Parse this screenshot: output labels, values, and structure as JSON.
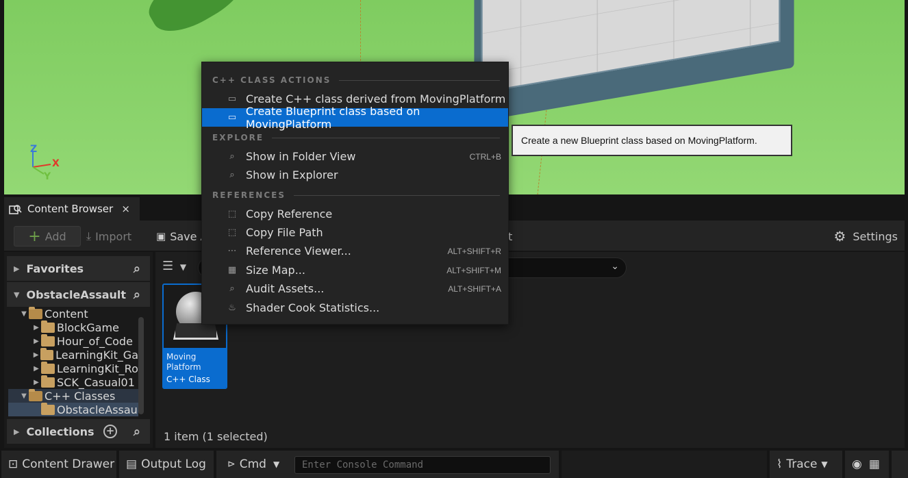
{
  "viewport": {
    "axis": {
      "z": "Z",
      "x": "X",
      "y": "Y"
    },
    "colors": {
      "ground": "#8fd46f",
      "x_axis": "#e03a2a",
      "y_axis": "#70c040",
      "z_axis": "#3a7ad8"
    }
  },
  "content_browser_tab": {
    "title": "Content Browser",
    "close": "×"
  },
  "toolbar": {
    "add_label": "Add",
    "import_label": "Import",
    "save_label": "Save A",
    "trailing_fragment": "t",
    "settings_label": "Settings"
  },
  "left_panel": {
    "favorites_label": "Favorites",
    "project_label": "ObstacleAssault",
    "collections_label": "Collections",
    "tree": [
      {
        "label": "Content"
      },
      {
        "label": "BlockGame"
      },
      {
        "label": "Hour_of_Code"
      },
      {
        "label": "LearningKit_Ga"
      },
      {
        "label": "LearningKit_Ro"
      },
      {
        "label": "SCK_Casual01"
      },
      {
        "label": "C++ Classes"
      },
      {
        "label": "ObstacleAssau"
      }
    ]
  },
  "assets": {
    "tile": {
      "name_line1": "Moving",
      "name_line2": "Platform",
      "type": "C++ Class"
    },
    "status": "1 item (1 selected)"
  },
  "bottom_bar": {
    "content_drawer": "Content Drawer",
    "output_log": "Output Log",
    "cmd": "Cmd",
    "console_placeholder": "Enter Console Command",
    "trace": "Trace"
  },
  "context_menu": {
    "sections": {
      "cpp_class_actions": "C++ CLASS ACTIONS",
      "explore": "EXPLORE",
      "references": "REFERENCES"
    },
    "items": {
      "create_cpp": {
        "label": "Create C++ class derived from MovingPlatform",
        "shortcut": ""
      },
      "create_bp": {
        "label": "Create Blueprint class based on MovingPlatform",
        "shortcut": ""
      },
      "folder_view": {
        "label": "Show in Folder View",
        "shortcut": "CTRL+B"
      },
      "explorer": {
        "label": "Show in Explorer",
        "shortcut": ""
      },
      "copy_ref": {
        "label": "Copy Reference",
        "shortcut": ""
      },
      "copy_path": {
        "label": "Copy File Path",
        "shortcut": ""
      },
      "ref_viewer": {
        "label": "Reference Viewer...",
        "shortcut": "ALT+SHIFT+R"
      },
      "size_map": {
        "label": "Size Map...",
        "shortcut": "ALT+SHIFT+M"
      },
      "audit": {
        "label": "Audit Assets...",
        "shortcut": "ALT+SHIFT+A"
      },
      "shader_stats": {
        "label": "Shader Cook Statistics...",
        "shortcut": ""
      }
    }
  },
  "tooltip": {
    "text": "Create a new Blueprint class based on MovingPlatform."
  },
  "accent_color": "#0a6ccf"
}
